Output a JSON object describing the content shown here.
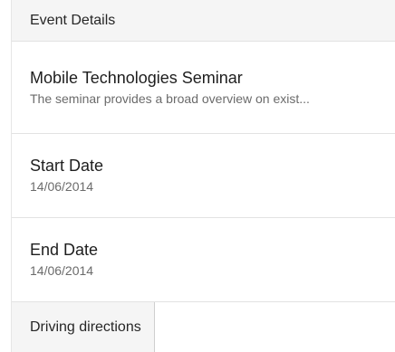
{
  "header": {
    "title": "Event Details"
  },
  "event": {
    "name": "Mobile Technologies Seminar",
    "description": "The seminar provides a broad overview on exist..."
  },
  "start": {
    "label": "Start Date",
    "value": "14/06/2014"
  },
  "end": {
    "label": "End Date",
    "value": "14/06/2014"
  },
  "footer": {
    "directions_label": "Driving directions"
  }
}
